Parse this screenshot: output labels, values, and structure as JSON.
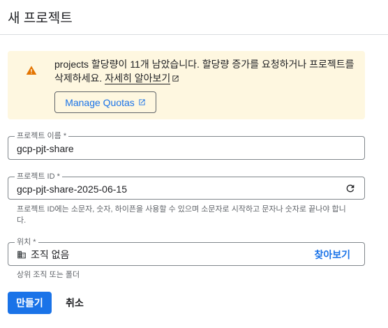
{
  "dialog": {
    "title": "새 프로젝트"
  },
  "warning": {
    "message": "projects 할당량이 11개 남았습니다. 할당량 증가를 요청하거나 프로젝트를 삭제하세요.",
    "learn_more": "자세히 알아보기",
    "manage_quotas": "Manage Quotas",
    "icon": "warning-icon",
    "icon_color": "#e37400",
    "background": "#fef7e0"
  },
  "fields": {
    "project_name": {
      "label": "프로젝트 이름 *",
      "value": "gcp-pjt-share"
    },
    "project_id": {
      "label": "프로젝트 ID *",
      "value": "gcp-pjt-share-2025-06-15",
      "hint": "프로젝트 ID에는 소문자, 숫자, 하이픈을 사용할 수 있으며 소문자로 시작하고 문자나 숫자로 끝나야 합니다."
    },
    "location": {
      "label": "위치 *",
      "value": "조직 없음",
      "browse": "찾아보기",
      "hint": "상위 조직 또는 폴더"
    }
  },
  "actions": {
    "create": "만들기",
    "cancel": "취소"
  },
  "colors": {
    "accent": "#1a73e8"
  }
}
